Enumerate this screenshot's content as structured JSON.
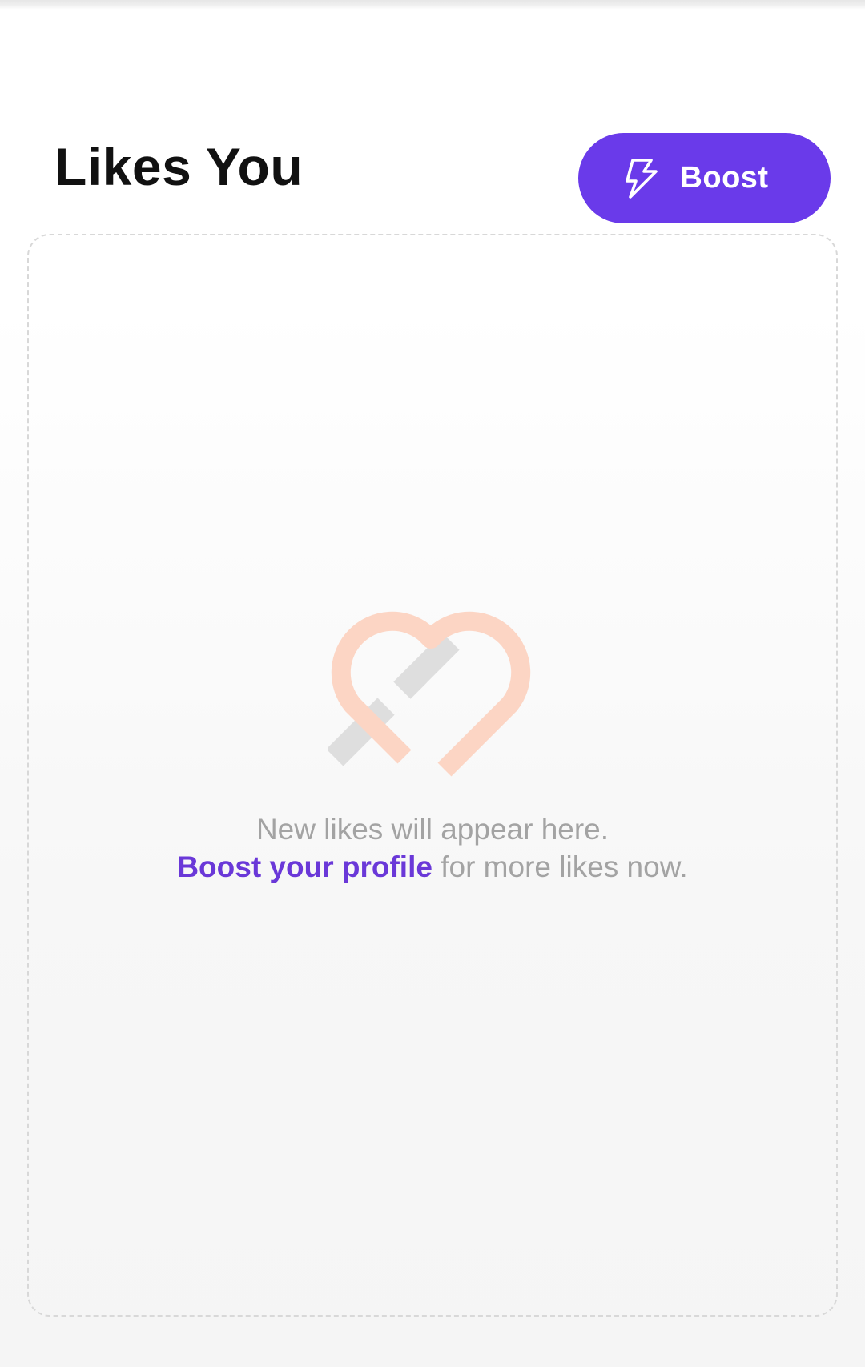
{
  "header": {
    "title": "Likes You",
    "boost_button": {
      "label": "Boost",
      "icon": "lightning-bolt-icon"
    }
  },
  "empty_state": {
    "illustration": "heart-icon",
    "line1": "New likes will appear here.",
    "link_text": "Boost your profile",
    "line2_suffix": " for more likes now."
  },
  "colors": {
    "accent": "#6a3aea",
    "link": "#6a38d8",
    "heart": "#fcd5c4",
    "muted_text": "#a3a3a3"
  }
}
